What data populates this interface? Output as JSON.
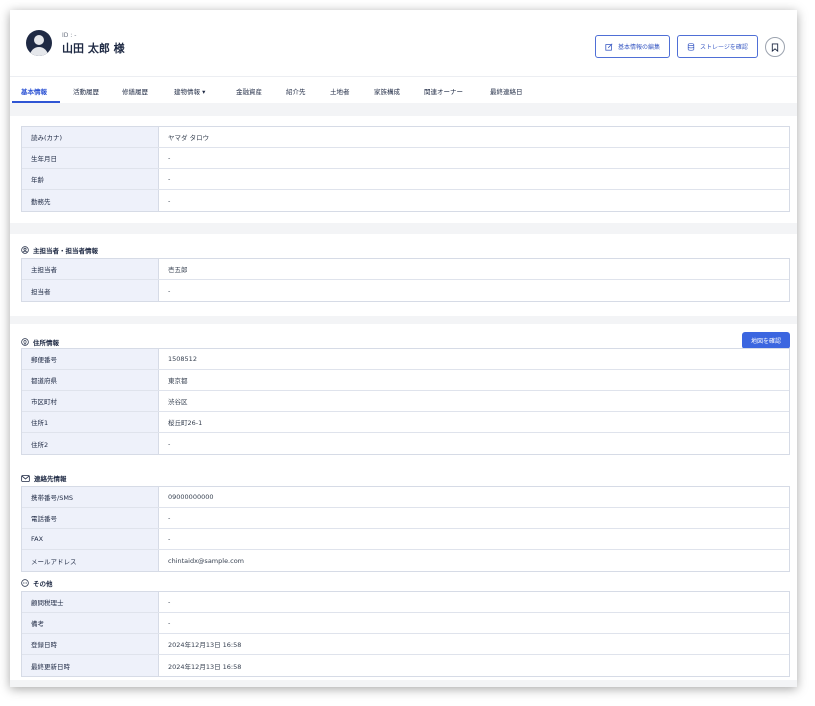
{
  "header": {
    "id_label": "ID : -",
    "customer_name": "山田 太郎 様",
    "edit_button": "基本情報の編集",
    "storage_button": "ストレージを確認"
  },
  "tabs": [
    {
      "label": "基本情報"
    },
    {
      "label": "活動履歴"
    },
    {
      "label": "修繕履歴"
    },
    {
      "label": "建物情報 ▾"
    },
    {
      "label": "金融資産"
    },
    {
      "label": "紹介先"
    },
    {
      "label": "土地者"
    },
    {
      "label": "家族構成"
    },
    {
      "label": "関連オーナー"
    },
    {
      "label": "最終連絡日"
    }
  ],
  "basic_info": [
    {
      "label": "読み(カナ)",
      "value": "ヤマダ タロウ"
    },
    {
      "label": "生年月日",
      "value": "-"
    },
    {
      "label": "年齢",
      "value": "-"
    },
    {
      "label": "勤務先",
      "value": "-"
    }
  ],
  "staff": {
    "title": "主担当者・担当者情報",
    "rows": [
      {
        "label": "主担当者",
        "value": "壱五郎"
      },
      {
        "label": "担当者",
        "value": "-"
      }
    ]
  },
  "address": {
    "title": "住所情報",
    "map_button": "地図を確認",
    "rows": [
      {
        "label": "郵便番号",
        "value": "1508512"
      },
      {
        "label": "都道府県",
        "value": "東京都"
      },
      {
        "label": "市区町村",
        "value": "渋谷区"
      },
      {
        "label": "住所1",
        "value": "桜丘町26-1"
      },
      {
        "label": "住所2",
        "value": "-"
      }
    ]
  },
  "contact": {
    "title": "連絡先情報",
    "rows": [
      {
        "label": "携帯番号/SMS",
        "value": "09000000000"
      },
      {
        "label": "電話番号",
        "value": "-"
      },
      {
        "label": "FAX",
        "value": "-"
      },
      {
        "label": "メールアドレス",
        "value": "chintaidx@sample.com"
      }
    ]
  },
  "other": {
    "title": "その他",
    "rows": [
      {
        "label": "顧問税理士",
        "value": "-"
      },
      {
        "label": "備考",
        "value": "-"
      },
      {
        "label": "登録日時",
        "value": "2024年12月13日 16:58"
      },
      {
        "label": "最終更新日時",
        "value": "2024年12月13日 16:58"
      }
    ]
  },
  "colors": {
    "accent": "#2f55d4",
    "label_bg": "#eef1fa",
    "page_bg": "#f3f4f6"
  }
}
